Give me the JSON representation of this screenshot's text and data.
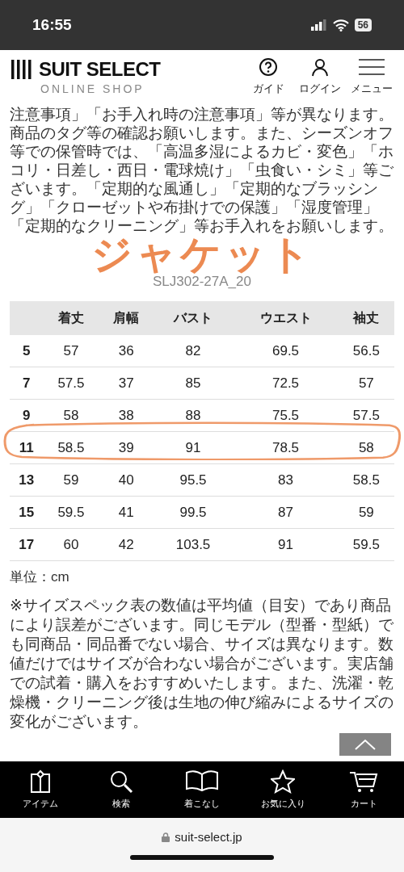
{
  "status_bar": {
    "time": "16:55",
    "battery": "56"
  },
  "header": {
    "logo": "SUIT SELECT",
    "tagline": "ONLINE SHOP",
    "nav": [
      {
        "kind": "guide",
        "label": "ガイド"
      },
      {
        "kind": "login",
        "label": "ログイン"
      },
      {
        "kind": "menu",
        "label": "メニュー"
      }
    ]
  },
  "care_text": "注意事項」「お手入れ時の注意事項」等が異なります。商品のタグ等の確認お願いします。また、シーズンオフ等での保管時では、「高温多湿によるカビ・変色」「ホコリ・日差し・西日・電球焼け」「虫食い・シミ」等ございます。「定期的な風通し」「定期的なブラッシング」「クローゼットや布掛けでの保護」「湿度管理」「定期的なクリーニング」等お手入れをお願いします。",
  "product_title": "ジャケット",
  "product_code": "SLJ302-27A_20",
  "size_table": {
    "columns": [
      "着丈",
      "肩幅",
      "バスト",
      "ウエスト",
      "袖丈"
    ],
    "rows": [
      {
        "size": "5",
        "values": [
          "57",
          "36",
          "82",
          "69.5",
          "56.5"
        ],
        "circled": false
      },
      {
        "size": "7",
        "values": [
          "57.5",
          "37",
          "85",
          "72.5",
          "57"
        ],
        "circled": false
      },
      {
        "size": "9",
        "values": [
          "58",
          "38",
          "88",
          "75.5",
          "57.5"
        ],
        "circled": false
      },
      {
        "size": "11",
        "values": [
          "58.5",
          "39",
          "91",
          "78.5",
          "58"
        ],
        "circled": true
      },
      {
        "size": "13",
        "values": [
          "59",
          "40",
          "95.5",
          "83",
          "58.5"
        ],
        "circled": false
      },
      {
        "size": "15",
        "values": [
          "59.5",
          "41",
          "99.5",
          "87",
          "59"
        ],
        "circled": false
      },
      {
        "size": "17",
        "values": [
          "60",
          "42",
          "103.5",
          "91",
          "59.5"
        ],
        "circled": false
      }
    ]
  },
  "unit": "単位：cm",
  "note": "※サイズスペック表の数値は平均値（目安）であり商品により誤差がございます。同じモデル（型番・型紙）でも同商品・同品番でない場合、サイズは異なります。数値だけではサイズが合わない場合がございます。実店舗での試着・購入をおすすめいたします。また、洗濯・乾燥機・クリーニング後は生地の伸び縮みによるサイズの変化がございます。",
  "tab_bar": [
    {
      "kind": "item",
      "label": "アイテム"
    },
    {
      "kind": "search",
      "label": "検索"
    },
    {
      "kind": "styling",
      "label": "着こなし"
    },
    {
      "kind": "favorite",
      "label": "お気に入り"
    },
    {
      "kind": "cart",
      "label": "カート"
    }
  ],
  "url_bar": {
    "url": "suit-select.jp"
  }
}
